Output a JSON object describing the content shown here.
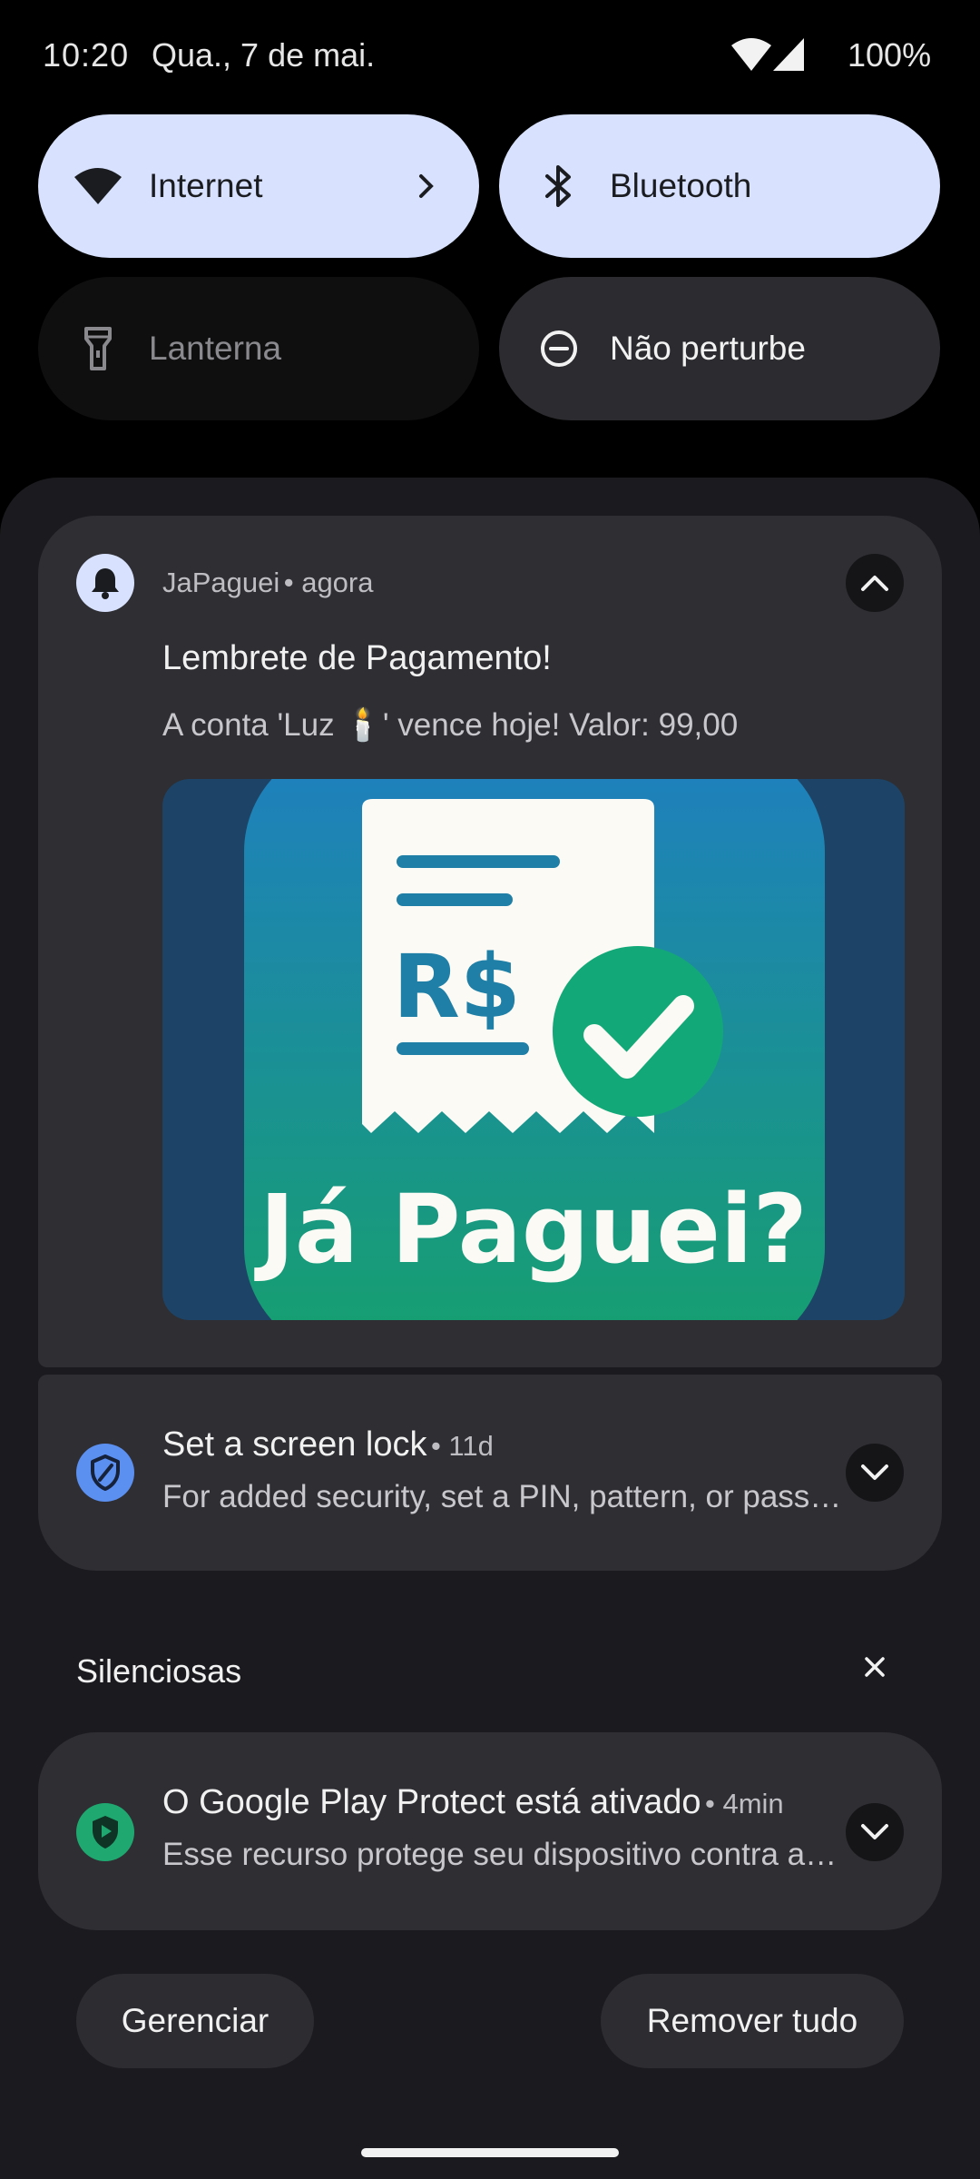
{
  "status_bar": {
    "time": "10:20",
    "date": "Qua., 7 de mai.",
    "battery": "100%"
  },
  "quick_settings": {
    "tiles": [
      {
        "label": "Internet",
        "icon": "wifi-icon",
        "state": "on"
      },
      {
        "label": "Bluetooth",
        "icon": "bluetooth-icon",
        "state": "on"
      },
      {
        "label": "Lanterna",
        "icon": "flashlight-icon",
        "state": "off"
      },
      {
        "label": "Não perturbe",
        "icon": "do-not-disturb-icon",
        "state": "neutral"
      }
    ]
  },
  "notifications": {
    "japaguei": {
      "app_name": "JaPaguei",
      "time": "agora",
      "title": "Lembrete de Pagamento!",
      "text": "A conta 'Luz 🕯️' vence hoje! Valor: 99,00",
      "image": {
        "currency_text": "R$",
        "brand_text": "Já Paguei?"
      }
    },
    "screen_lock": {
      "title": "Set a screen lock",
      "time": "11d",
      "text": "For added security, set a PIN, pattern, or password"
    }
  },
  "silent_section": {
    "header": "Silenciosas",
    "play_protect": {
      "title": "O Google Play Protect está ativado",
      "time": "4min",
      "text": "Esse recurso protege seu dispositivo contra apps nocivos"
    }
  },
  "footer": {
    "manage_label": "Gerenciar",
    "clear_all_label": "Remover tudo"
  },
  "colors": {
    "tile_on": "#d8e2ff",
    "shade_bg": "#1b1b1f",
    "card_bg": "#2e2e33",
    "shield_blue": "#5b8ff0",
    "play_protect_green": "#1fa971",
    "brand_blue": "#1f7fc0",
    "brand_green": "#16a06e"
  }
}
